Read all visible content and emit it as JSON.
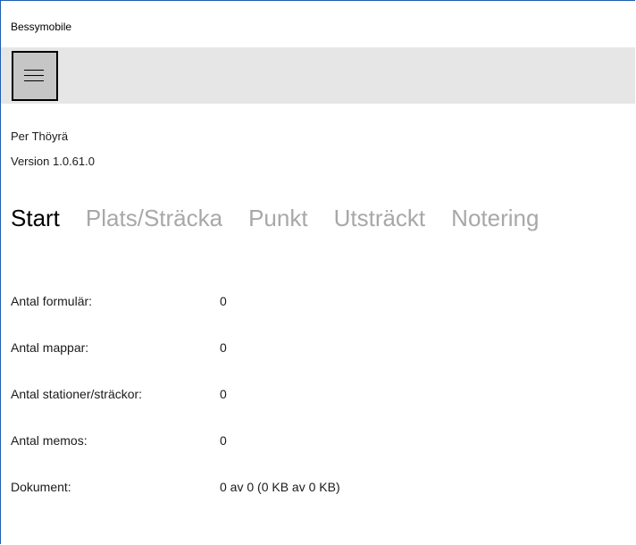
{
  "window": {
    "title": "Bessymobile"
  },
  "toolbar": {
    "menu_icon": "hamburger-menu-icon"
  },
  "user": {
    "name": "Per Thöyrä",
    "version": "Version 1.0.61.0"
  },
  "tabs": [
    {
      "label": "Start",
      "active": true
    },
    {
      "label": "Plats/Sträcka",
      "active": false
    },
    {
      "label": "Punkt",
      "active": false
    },
    {
      "label": "Utsträckt",
      "active": false
    },
    {
      "label": "Notering",
      "active": false
    }
  ],
  "stats": [
    {
      "label": "Antal formulär:",
      "value": "0"
    },
    {
      "label": "Antal mappar:",
      "value": "0"
    },
    {
      "label": "Antal stationer/sträckor:",
      "value": "0"
    },
    {
      "label": "Antal memos:",
      "value": "0"
    },
    {
      "label": "Dokument:",
      "value": "0 av 0 (0 KB av 0 KB)"
    }
  ],
  "colors": {
    "window_border": "#1f5fb0",
    "toolbar_bg": "#e6e6e6",
    "tab_active": "#000000",
    "tab_inactive": "#a8a8a8"
  }
}
